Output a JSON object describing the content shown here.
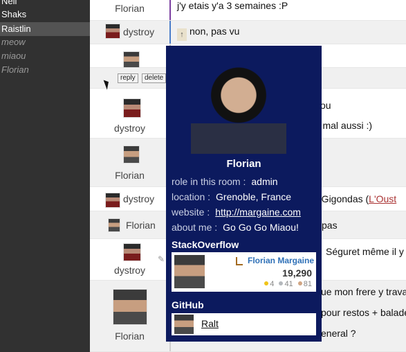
{
  "users": [
    {
      "name": "Neil",
      "style": "online"
    },
    {
      "name": "Shaks",
      "style": "online"
    },
    {
      "name": "Raistlin",
      "style": "selected"
    },
    {
      "name": "meow",
      "style": "away"
    },
    {
      "name": "miaou",
      "style": "away"
    },
    {
      "name": "Florian",
      "style": "away"
    }
  ],
  "messages": [
    {
      "author": "Florian",
      "text": "j'y etais y'a 3 semaines :P"
    },
    {
      "author": "dystroy",
      "reply_icon": "↑",
      "text": "non, pas vu"
    },
    {
      "author": "",
      "text": "ou"
    },
    {
      "author": "dystroy",
      "text": "pas mal aussi :)"
    },
    {
      "author": "Florian",
      "text": ""
    },
    {
      "author": "dystroy",
      "text_prefix": "à Gigondas (",
      "link": "L'Oust"
    },
    {
      "author": "Florian",
      "text": "pas"
    },
    {
      "author": "dystroy",
      "text": "Séguret même il y"
    },
    {
      "author": "Florian",
      "lines": [
        "ue mon frere y trava",
        "pour restos + balade",
        "eneral ?"
      ]
    }
  ],
  "message_actions": {
    "reply": "reply",
    "delete": "delete"
  },
  "profile": {
    "name": "Florian",
    "fields": [
      {
        "label": "role in this room :",
        "value": "admin"
      },
      {
        "label": "location :",
        "value": "Grenoble, France"
      },
      {
        "label": "website :",
        "value": "http://margaine.com"
      },
      {
        "label": "about me :",
        "value": "Go Go Go Miaou!"
      }
    ],
    "stackoverflow": {
      "heading": "StackOverflow",
      "display_name": "Florian Margaine",
      "reputation": "19,290",
      "badges": {
        "gold": "4",
        "silver": "41",
        "bronze": "81"
      },
      "badge_colors": {
        "gold": "#f0c419",
        "silver": "#b4b8bc",
        "bronze": "#d1a684"
      }
    },
    "github": {
      "heading": "GitHub",
      "repo": "Ralt"
    }
  },
  "colors": {
    "sidebar_bg": "#313131",
    "popup_bg": "#0c1a5e",
    "link_red": "#a33"
  }
}
